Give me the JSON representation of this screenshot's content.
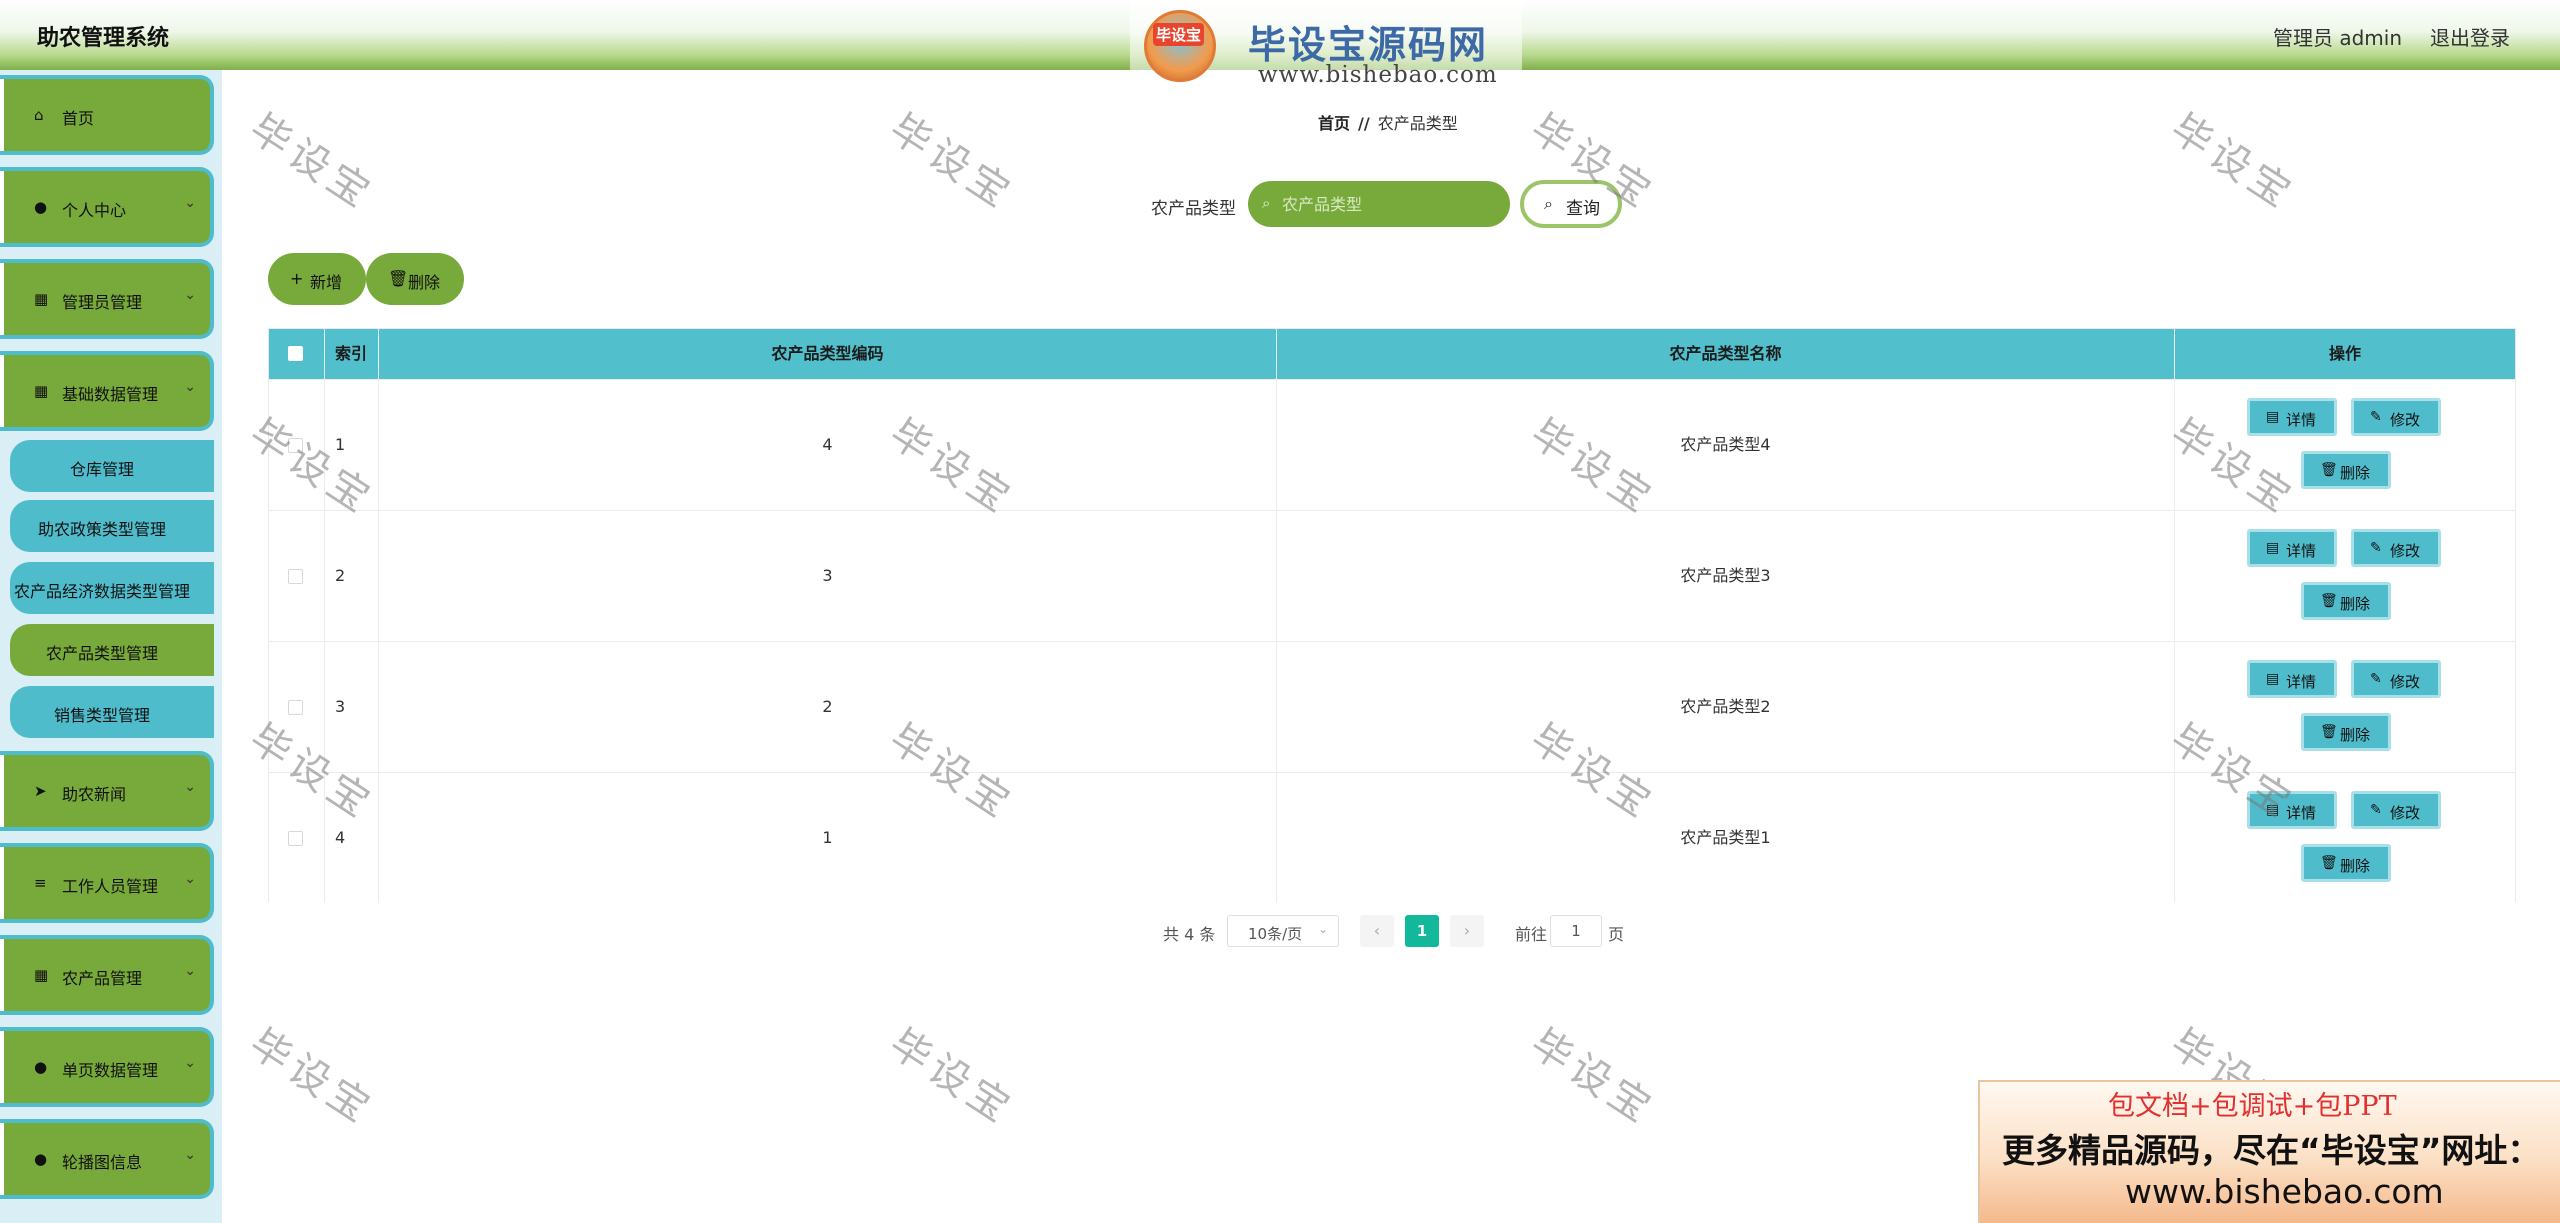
{
  "header": {
    "app_title": "助农管理系统",
    "user_label": "管理员 admin",
    "logout_label": "退出登录"
  },
  "watermark_logo": {
    "badge_text": "毕设宝",
    "name": "毕设宝源码网",
    "url": "www.bishebao.com"
  },
  "sidebar": {
    "items": [
      {
        "label": "首页",
        "icon": "home-icon",
        "glyph": "⌂"
      },
      {
        "label": "个人中心",
        "icon": "user-icon",
        "glyph": "●"
      },
      {
        "label": "管理员管理",
        "icon": "grid-icon",
        "glyph": "▦"
      },
      {
        "label": "基础数据管理",
        "icon": "grid-icon",
        "glyph": "▦"
      },
      {
        "label": "助农新闻",
        "icon": "send-icon",
        "glyph": "➤"
      },
      {
        "label": "工作人员管理",
        "icon": "menu-icon",
        "glyph": "≡"
      },
      {
        "label": "农产品管理",
        "icon": "grid-icon",
        "glyph": "▦"
      },
      {
        "label": "单页数据管理",
        "icon": "location-icon",
        "glyph": "●"
      },
      {
        "label": "轮播图信息",
        "icon": "user-icon",
        "glyph": "●"
      }
    ],
    "sub_items": [
      {
        "label": "仓库管理",
        "active": false
      },
      {
        "label": "助农政策类型管理",
        "active": false
      },
      {
        "label": "农产品经济数据类型管理",
        "active": false
      },
      {
        "label": "农产品类型管理",
        "active": true
      },
      {
        "label": "销售类型管理",
        "active": false
      }
    ],
    "arrow": "⌄"
  },
  "breadcrumb": {
    "home": "首页",
    "separator": "//",
    "current": "农产品类型"
  },
  "search": {
    "label": "农产品类型",
    "placeholder": "农产品类型",
    "button_label": "查询"
  },
  "actions": {
    "add_label": "新增",
    "delete_label": "删除"
  },
  "table": {
    "columns": [
      "索引",
      "农产品类型编码",
      "农产品类型名称",
      "操作"
    ],
    "rows": [
      {
        "index": "1",
        "code": "4",
        "name": "农产品类型4"
      },
      {
        "index": "2",
        "code": "3",
        "name": "农产品类型3"
      },
      {
        "index": "3",
        "code": "2",
        "name": "农产品类型2"
      },
      {
        "index": "4",
        "code": "1",
        "name": "农产品类型1"
      }
    ],
    "op_detail": "详情",
    "op_edit": "修改",
    "op_delete": "删除"
  },
  "pagination": {
    "total": "共 4 条",
    "page_size": "10条/页",
    "prev": "‹",
    "next": "›",
    "current_page": "1",
    "goto_label": "前往",
    "goto_value": "1",
    "page_suffix": "页"
  },
  "watermark_text": "毕设宝",
  "promo": {
    "line1": "包文档+包调试+包PPT",
    "line2": "更多精品源码，尽在“毕设宝”网址：",
    "line3": "www.bishebao.com"
  },
  "colors": {
    "green": "#78a93b",
    "teal": "#4fbccc",
    "table_header": "#52bfcc",
    "page_active": "#13b89a"
  }
}
